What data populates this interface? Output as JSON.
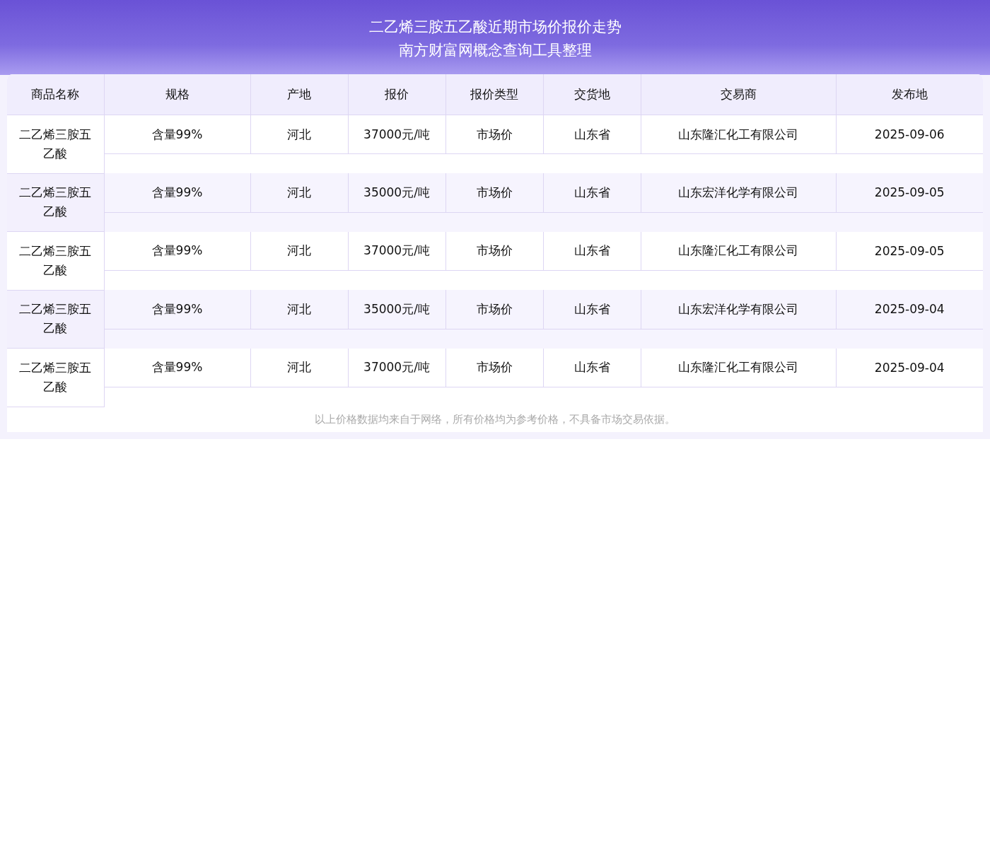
{
  "header": {
    "title": "二乙烯三胺五乙酸近期市场价报价走势",
    "subtitle": "南方财富网概念查询工具整理"
  },
  "table": {
    "columns": [
      "商品名称",
      "规格",
      "产地",
      "报价",
      "报价类型",
      "交货地",
      "交易商",
      "发布地"
    ],
    "rows": [
      [
        "二乙烯三胺五乙酸",
        "含量99%",
        "河北",
        "37000元/吨",
        "市场价",
        "山东省",
        "山东隆汇化工有限公司",
        "2025-09-06"
      ],
      [
        "二乙烯三胺五乙酸",
        "含量99%",
        "河北",
        "35000元/吨",
        "市场价",
        "山东省",
        "山东宏洋化学有限公司",
        "2025-09-05"
      ],
      [
        "二乙烯三胺五乙酸",
        "含量99%",
        "河北",
        "37000元/吨",
        "市场价",
        "山东省",
        "山东隆汇化工有限公司",
        "2025-09-05"
      ],
      [
        "二乙烯三胺五乙酸",
        "含量99%",
        "河北",
        "35000元/吨",
        "市场价",
        "山东省",
        "山东宏洋化学有限公司",
        "2025-09-04"
      ],
      [
        "二乙烯三胺五乙酸",
        "含量99%",
        "河北",
        "37000元/吨",
        "市场价",
        "山东省",
        "山东隆汇化工有限公司",
        "2025-09-04"
      ]
    ]
  },
  "footnote": "以上价格数据均来自于网络，所有价格均为参考价格，不具备市场交易依据。"
}
